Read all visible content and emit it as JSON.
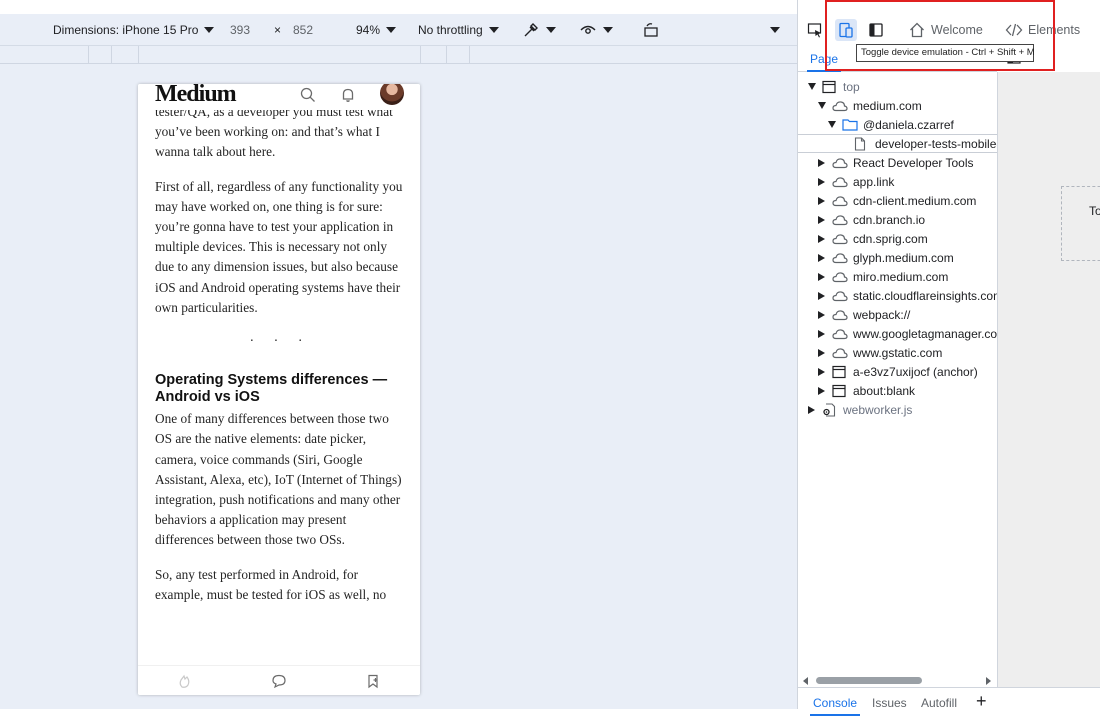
{
  "device_toolbar": {
    "dimensions_label": "Dimensions: iPhone 15 Pro",
    "width": "393",
    "times": "×",
    "height": "852",
    "zoom": "94%",
    "throttling": "No throttling"
  },
  "phone": {
    "logo": "Medium",
    "header_icons": [
      "search-icon",
      "bell-icon",
      "avatar"
    ],
    "paragraphs": {
      "p0": "tester/QA, as a developer you must test what you’ve been working on: and that’s what I wanna talk about here.",
      "p1": "First of all, regardless of any functionality you may have worked on, one thing is for sure: you’re gonna have to test your application in multiple devices. This is necessary not only due to any dimension issues, but also because iOS and Android operating systems have their own particularities.",
      "dots": "· · ·",
      "heading": "Operating Systems differences — Android vs iOS",
      "p2": "One of many differences between those two OS are the native elements: date picker, camera, voice commands (Siri, Google Assistant, Alexa, etc), IoT (Internet of Things) integration, push notifications and many other behaviors a application may present differences between those two OSs.",
      "p3": "So, any test performed in Android, for example, must be tested for iOS as well, no"
    },
    "footer_icons": [
      "clap-icon",
      "comment-icon",
      "bookmark-icon"
    ]
  },
  "devtools": {
    "tabs": {
      "welcome": "Welcome",
      "elements": "Elements"
    },
    "tooltip": "Toggle device emulation - Ctrl + Shift + M",
    "subtab_page": "Page",
    "tree": [
      {
        "label": "top",
        "level": 0,
        "arrow": "down",
        "icon": "frame-icon",
        "muted": true
      },
      {
        "label": "medium.com",
        "level": 1,
        "arrow": "down",
        "icon": "cloud-icon"
      },
      {
        "label": "@daniela.czarref",
        "level": 2,
        "arrow": "down",
        "icon": "folder-icon"
      },
      {
        "label": "developer-tests-mobile-",
        "level": 3,
        "arrow": "none",
        "icon": "file-icon",
        "selected": true
      },
      {
        "label": "React Developer Tools",
        "level": 1,
        "arrow": "right",
        "icon": "cloud-icon"
      },
      {
        "label": "app.link",
        "level": 1,
        "arrow": "right",
        "icon": "cloud-icon"
      },
      {
        "label": "cdn-client.medium.com",
        "level": 1,
        "arrow": "right",
        "icon": "cloud-icon"
      },
      {
        "label": "cdn.branch.io",
        "level": 1,
        "arrow": "right",
        "icon": "cloud-icon"
      },
      {
        "label": "cdn.sprig.com",
        "level": 1,
        "arrow": "right",
        "icon": "cloud-icon"
      },
      {
        "label": "glyph.medium.com",
        "level": 1,
        "arrow": "right",
        "icon": "cloud-icon"
      },
      {
        "label": "miro.medium.com",
        "level": 1,
        "arrow": "right",
        "icon": "cloud-icon"
      },
      {
        "label": "static.cloudflareinsights.com",
        "level": 1,
        "arrow": "right",
        "icon": "cloud-icon"
      },
      {
        "label": "webpack://",
        "level": 1,
        "arrow": "right",
        "icon": "cloud-icon"
      },
      {
        "label": "www.googletagmanager.con",
        "level": 1,
        "arrow": "right",
        "icon": "cloud-icon"
      },
      {
        "label": "www.gstatic.com",
        "level": 1,
        "arrow": "right",
        "icon": "cloud-icon"
      },
      {
        "label": "a-e3vz7uxijocf (anchor)",
        "level": 1,
        "arrow": "right",
        "icon": "frame-icon"
      },
      {
        "label": "about:blank",
        "level": 1,
        "arrow": "right",
        "icon": "frame-icon"
      },
      {
        "label": "webworker.js",
        "level": 0,
        "arrow": "right",
        "icon": "gear-file-icon",
        "muted": true
      }
    ],
    "preview_text": "To",
    "drawer": {
      "console": "Console",
      "issues": "Issues",
      "autofill": "Autofill",
      "add": "+"
    }
  },
  "colors": {
    "accent": "#1a73e8",
    "highlight": "#e02020",
    "emulation_bg": "#e9eef7"
  }
}
